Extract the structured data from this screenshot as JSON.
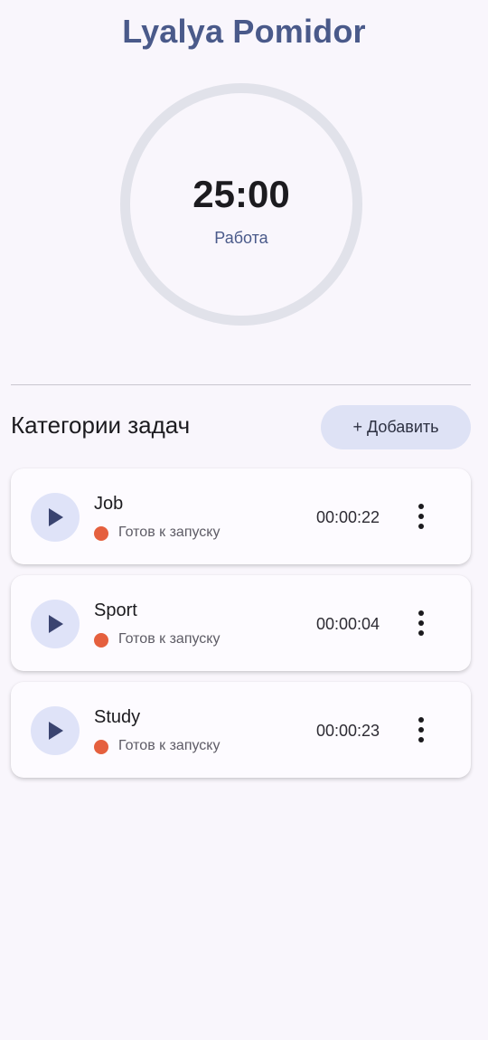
{
  "app": {
    "title": "Lyalya Pomidor"
  },
  "timer": {
    "time": "25:00",
    "mode": "Работа"
  },
  "categories": {
    "title": "Категории задач",
    "add_label": "+ Добавить",
    "items": [
      {
        "name": "Job",
        "status": "Готов к запуску",
        "elapsed": "00:00:22",
        "play_icon": "play-icon",
        "menu_icon": "more-vert-icon"
      },
      {
        "name": "Sport",
        "status": "Готов к запуску",
        "elapsed": "00:00:04",
        "play_icon": "play-icon",
        "menu_icon": "more-vert-icon"
      },
      {
        "name": "Study",
        "status": "Готов к запуску",
        "elapsed": "00:00:23",
        "play_icon": "play-icon",
        "menu_icon": "more-vert-icon"
      }
    ]
  },
  "colors": {
    "accent": "#4a5a8a",
    "status_ready": "#e5603e",
    "ring": "#e1e2ea",
    "add_button_bg": "#dee2f5",
    "play_button_bg": "#dfe3f8",
    "background": "#f9f6fc"
  }
}
